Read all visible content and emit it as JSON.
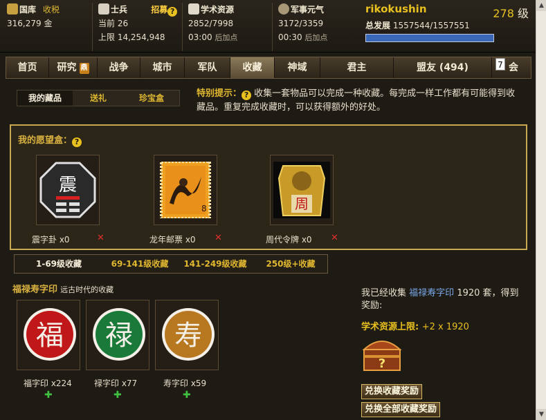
{
  "status": {
    "treasury": {
      "label": "国库",
      "side": "收税",
      "value": "316,279 金"
    },
    "soldiers": {
      "label": "士兵",
      "action": "招募",
      "current": "当前 26",
      "limit": "上限 14,254,948"
    },
    "research": {
      "label": "学术资源",
      "value": "2852/7998",
      "timer": "03:00",
      "suffix": "后加点"
    },
    "morale": {
      "label": "军事元气",
      "value": "3172/3359",
      "timer": "00:30",
      "suffix": "后加点"
    },
    "user": {
      "name": "rikokushin",
      "level": "278",
      "level_unit": "级",
      "dev_label": "总发展",
      "dev_value": "1557544/1557551",
      "progress": 0.9999
    }
  },
  "nav": {
    "items": [
      "首页",
      "研究",
      "战争",
      "城市",
      "军队",
      "收藏",
      "神域",
      "君主",
      "盟友 (494)",
      "会"
    ],
    "active": "收藏",
    "tip": "7",
    "research_badge": "鼎"
  },
  "subtabs": {
    "items": [
      "我的藏品",
      "送礼",
      "珍宝盒"
    ],
    "active": "我的藏品"
  },
  "notice": {
    "title": "特别提示：",
    "text": "收集一套物品可以完成一种收藏。每完成一样工作都有可能得到收藏品。重复完成收藏时，可以获得额外的好处。"
  },
  "wishlist": {
    "title": "我的愿望盒：",
    "items": [
      {
        "name": "震字卦 x0",
        "icon": "zhen-trigram-icon",
        "glyph": "震"
      },
      {
        "name": "龙年邮票 x0",
        "icon": "dragon-stamp-icon",
        "glyph": "8"
      },
      {
        "name": "周代令牌 x0",
        "icon": "zhou-token-icon",
        "glyph": "周"
      }
    ],
    "remove": "✕"
  },
  "levels": {
    "items": [
      "1-69级收藏",
      "69-141级收藏",
      "141-249级收藏",
      "250级+收藏"
    ],
    "active": "1-69级收藏"
  },
  "set": {
    "name": "福禄寿字印",
    "desc": "远古时代的收藏",
    "items": [
      {
        "name": "福字印 x224",
        "glyph": "福",
        "color": "#c01818"
      },
      {
        "name": "禄字印 x77",
        "glyph": "禄",
        "color": "#1a7a3a"
      },
      {
        "name": "寿字印 x59",
        "glyph": "寿",
        "color": "#b87820"
      }
    ],
    "plus": "✚"
  },
  "reward": {
    "collected_prefix": "我已经收集",
    "set_name": "福禄寿字印",
    "collected_suffix": "1920 套，得到奖励:",
    "reward_label": "学术资源上限:",
    "reward_value": "+2 x 1920",
    "chest_mark": "?",
    "btn_redeem": "兑换收藏奖励",
    "btn_redeem_all": "兑换全部收藏奖励"
  },
  "colors": {
    "gold": "#e8c020",
    "accent": "#d8b040",
    "bg": "#1e1a14"
  }
}
